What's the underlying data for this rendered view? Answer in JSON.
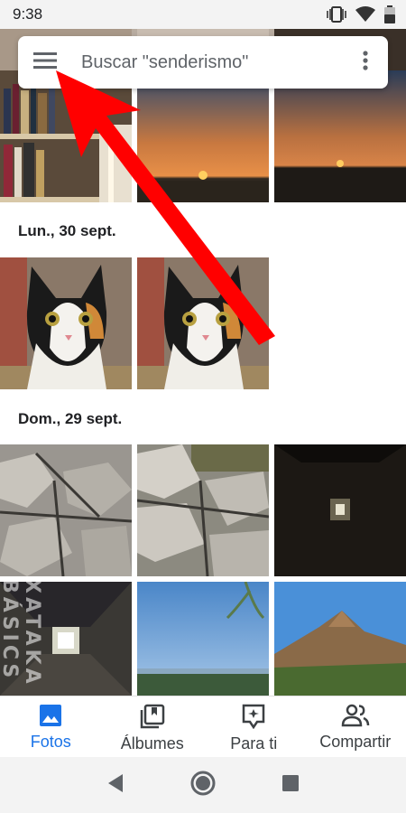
{
  "status_bar": {
    "time": "9:38"
  },
  "search": {
    "placeholder": "Buscar \"senderismo\""
  },
  "sections": [
    {
      "label": "Lun., 30 sept."
    },
    {
      "label": "Dom., 29 sept."
    }
  ],
  "bottom_nav": [
    {
      "label": "Fotos",
      "icon": "photo-icon",
      "active": true
    },
    {
      "label": "Álbumes",
      "icon": "album-icon",
      "active": false
    },
    {
      "label": "Para ti",
      "icon": "for-you-icon",
      "active": false
    },
    {
      "label": "Compartir",
      "icon": "share-people-icon",
      "active": false
    }
  ],
  "watermark": "XATAKA BÁSICS",
  "colors": {
    "accent": "#1a73e8",
    "arrow": "#ff0000"
  }
}
